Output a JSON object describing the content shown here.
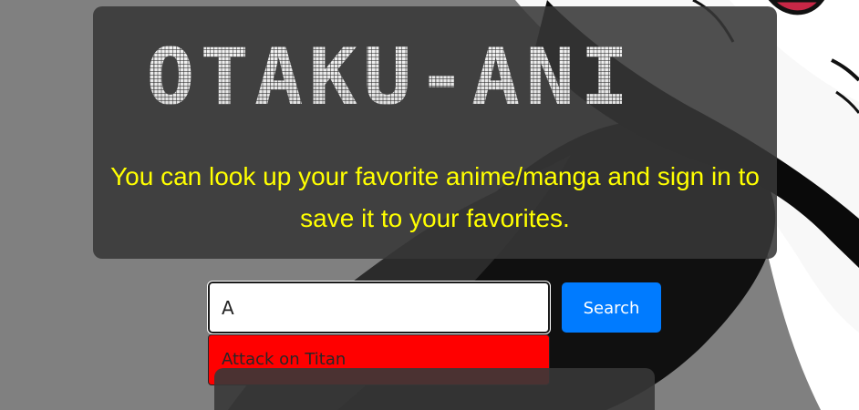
{
  "brand": {
    "logo_text": "OTAKU-ANI"
  },
  "hero": {
    "tagline": "You can look up your favorite anime/manga and sign in to save it to your favorites."
  },
  "search": {
    "query": "A",
    "button_label": "Search",
    "suggestions": [
      "Attack on Titan"
    ]
  },
  "colors": {
    "tagline": "#ffff00",
    "search_button": "#007bff",
    "suggestion_background": "#ff0000",
    "card_background": "#373737"
  }
}
